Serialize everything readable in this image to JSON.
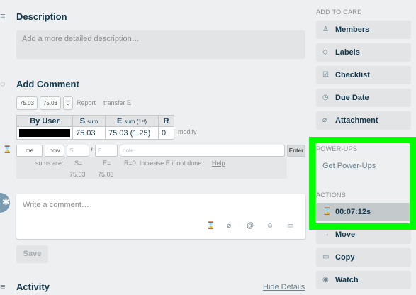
{
  "description": {
    "title": "Description",
    "placeholder": "Add a more detailed description…"
  },
  "add_comment": {
    "title": "Add Comment",
    "chips": [
      "75.03",
      "75.03",
      "0"
    ],
    "report_link": "Report",
    "transfer_link": "transfer E"
  },
  "sums_table": {
    "headers": {
      "user": "By User",
      "s_main": "S ",
      "s_sub": "sum",
      "e_main": "E ",
      "e_sub": "sum (1ˢᵗ)",
      "r": "R"
    },
    "row": {
      "user": "",
      "s": "75.03",
      "e": "75.03 (1.25)",
      "r": "0"
    },
    "modify_link": "modify"
  },
  "entry_row": {
    "user_value": "me",
    "time_value": "now",
    "s_placeholder": "S",
    "slash": "/",
    "e_placeholder": "E",
    "note_placeholder": "note",
    "enter_label": "Enter"
  },
  "sums_info": {
    "label": "sums are:",
    "s_label": "S=",
    "e_label": "E=",
    "hint": "R=0. Increase E if not done.",
    "help_link": "Help",
    "s_value": "75.03",
    "e_value": "75.03"
  },
  "comment": {
    "placeholder": "Write a comment…",
    "save_label": "Save"
  },
  "activity": {
    "title": "Activity",
    "hide_details": "Hide Details"
  },
  "sidebar": {
    "add_to_card_heading": "ADD TO CARD",
    "buttons": [
      {
        "label": "Members",
        "icon": "person-icon"
      },
      {
        "label": "Labels",
        "icon": "tag-icon"
      },
      {
        "label": "Checklist",
        "icon": "checkbox-icon"
      },
      {
        "label": "Due Date",
        "icon": "clock-icon"
      },
      {
        "label": "Attachment",
        "icon": "paperclip-icon"
      }
    ],
    "powerups_heading": "POWER-UPS",
    "get_powerups": "Get Power-Ups",
    "actions_heading": "ACTIONS",
    "timer_label": "00:07:12s",
    "action_buttons": [
      {
        "label": "Move",
        "icon": "arrow-right-icon"
      },
      {
        "label": "Copy",
        "icon": "copy-icon"
      },
      {
        "label": "Watch",
        "icon": "eye-icon"
      }
    ]
  },
  "colors": {
    "highlight_frame": "#00ff00",
    "background": "#edeff0",
    "button_bg": "#e2e4e6",
    "text": "#17394d"
  }
}
